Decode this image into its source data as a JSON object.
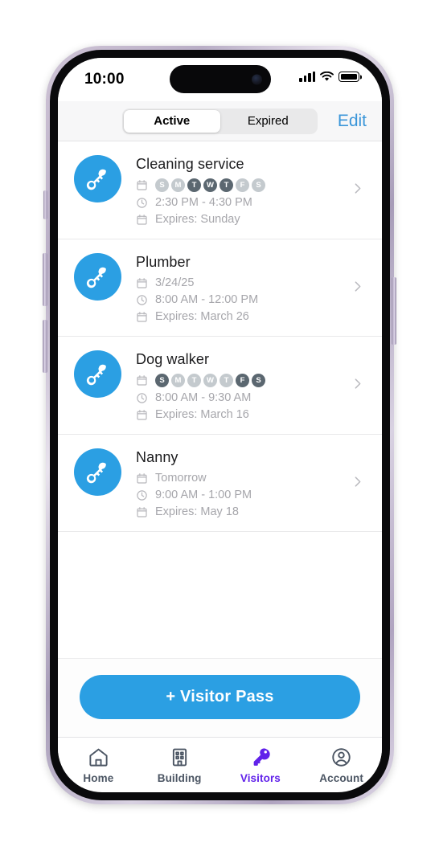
{
  "status_bar": {
    "time": "10:00",
    "signal_icon": "cellular-bars-icon",
    "wifi_icon": "wifi-icon",
    "battery_icon": "battery-icon"
  },
  "header": {
    "segments": [
      {
        "label": "Active",
        "selected": true
      },
      {
        "label": "Expired",
        "selected": false
      }
    ],
    "edit_label": "Edit"
  },
  "passes": [
    {
      "title": "Cleaning service",
      "schedule_type": "days",
      "days": [
        {
          "letter": "S",
          "active": false
        },
        {
          "letter": "M",
          "active": false
        },
        {
          "letter": "T",
          "active": true
        },
        {
          "letter": "W",
          "active": true
        },
        {
          "letter": "T",
          "active": true
        },
        {
          "letter": "F",
          "active": false
        },
        {
          "letter": "S",
          "active": false
        }
      ],
      "date_text": "",
      "time": "2:30 PM - 4:30 PM",
      "expires": "Expires: Sunday"
    },
    {
      "title": "Plumber",
      "schedule_type": "date",
      "days": [],
      "date_text": "3/24/25",
      "time": "8:00 AM - 12:00 PM",
      "expires": "Expires: March 26"
    },
    {
      "title": "Dog walker",
      "schedule_type": "days",
      "days": [
        {
          "letter": "S",
          "active": true
        },
        {
          "letter": "M",
          "active": false
        },
        {
          "letter": "T",
          "active": false
        },
        {
          "letter": "W",
          "active": false
        },
        {
          "letter": "T",
          "active": false
        },
        {
          "letter": "F",
          "active": true
        },
        {
          "letter": "S",
          "active": true
        }
      ],
      "date_text": "",
      "time": "8:00 AM - 9:30 AM",
      "expires": "Expires: March 16"
    },
    {
      "title": "Nanny",
      "schedule_type": "date",
      "days": [],
      "date_text": "Tomorrow",
      "time": "9:00 AM - 1:00 PM",
      "expires": "Expires: May 18"
    }
  ],
  "cta": {
    "label": "+ Visitor Pass"
  },
  "tabbar": {
    "items": [
      {
        "label": "Home",
        "icon": "home-icon",
        "active": false
      },
      {
        "label": "Building",
        "icon": "building-icon",
        "active": false
      },
      {
        "label": "Visitors",
        "icon": "key-icon",
        "active": true
      },
      {
        "label": "Account",
        "icon": "account-icon",
        "active": false
      }
    ]
  },
  "colors": {
    "accent_blue": "#2b9fe3",
    "link_blue": "#3b96d9",
    "active_purple": "#6122ea",
    "day_on": "#5b6770",
    "day_off": "#c4cace",
    "muted_text": "#a6a6ab"
  }
}
